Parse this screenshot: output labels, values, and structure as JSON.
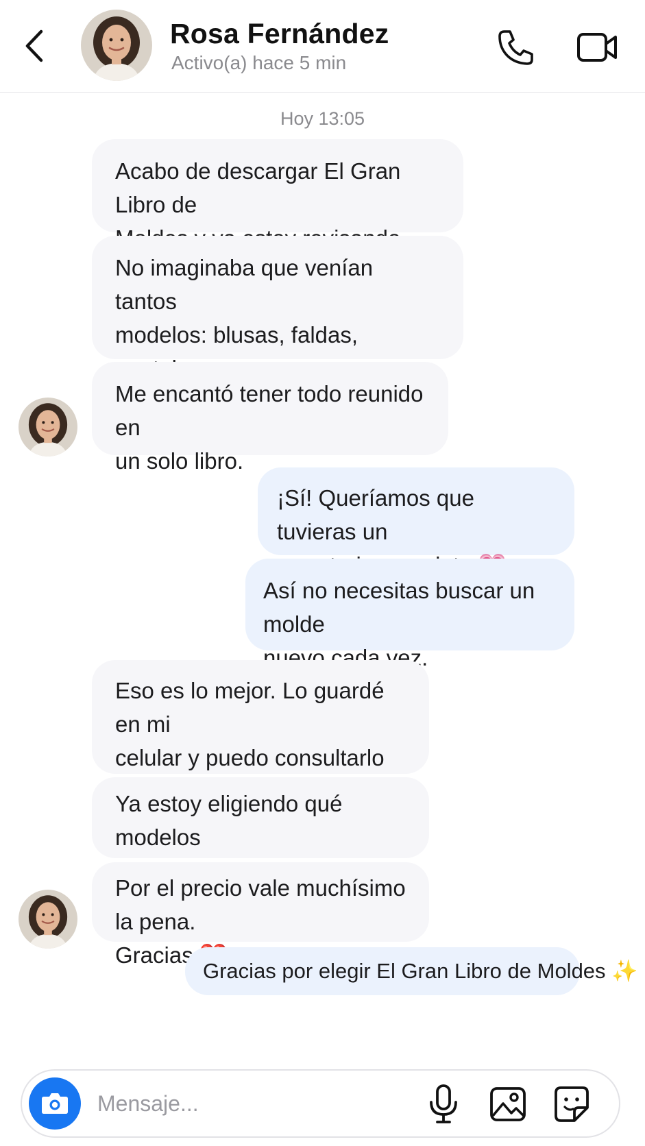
{
  "header": {
    "name": "Rosa Fernández",
    "status": "Activo(a) hace 5 min"
  },
  "icons": {
    "back": "chevron-left-icon",
    "call": "phone-icon",
    "video": "video-camera-icon",
    "camera": "camera-icon",
    "mic": "microphone-icon",
    "gallery": "image-icon",
    "sticker": "sticker-icon"
  },
  "conversation": {
    "date_separator": "Hoy 13:05",
    "messages": [
      {
        "from": "contact",
        "text": "Acabo de descargar El Gran Libro de\nMoldes y ya estoy revisando todo 😍"
      },
      {
        "from": "contact",
        "text": "No imaginaba que venían tantos\nmodelos: blusas, faldas, pantalones\ny vestidos."
      },
      {
        "from": "contact",
        "text": "Me encantó tener todo reunido en\nun solo libro."
      },
      {
        "from": "me",
        "text": "¡Sí! Queríamos que tuvieras un\nrepertorio completo 💗"
      },
      {
        "from": "me",
        "text": "Así no necesitas buscar un molde\nnuevo cada vez."
      },
      {
        "from": "contact",
        "text": "Eso es lo mejor. Lo guardé en mi\ncelular y puedo consultarlo cuando\nquiera 🙌"
      },
      {
        "from": "contact",
        "text": "Ya estoy eligiendo qué modelos\nofrecer esta semana."
      },
      {
        "from": "contact",
        "text": "Por el precio vale muchísimo la pena.\nGracias ❤️"
      },
      {
        "from": "me",
        "text": "Gracias por elegir El Gran Libro de Moldes ✨"
      }
    ]
  },
  "composer": {
    "placeholder": "Mensaje..."
  },
  "colors": {
    "incoming_bubble": "#f6f6f9",
    "outgoing_bubble": "#ebf2fd",
    "accent": "#1877f2"
  }
}
